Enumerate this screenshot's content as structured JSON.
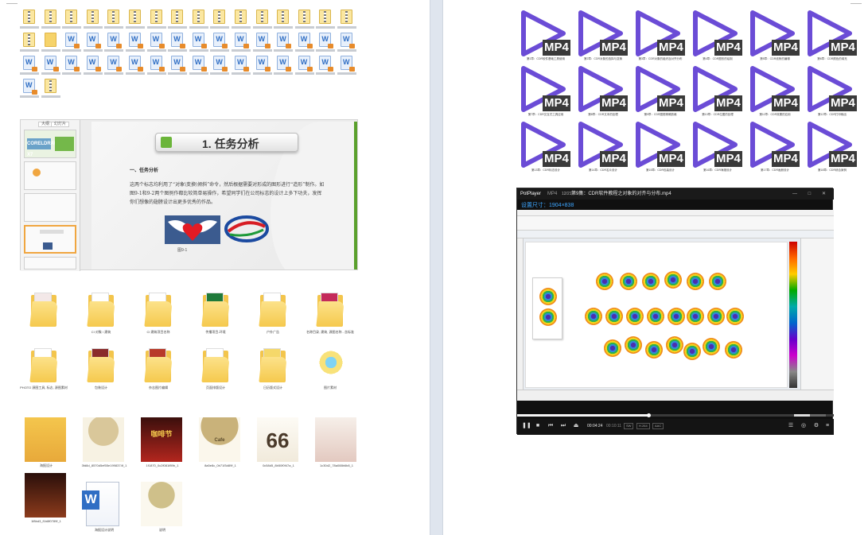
{
  "left_page": {
    "slide": {
      "tabs": [
        "大纲",
        "幻灯片"
      ],
      "title": "1. 任务分析",
      "heading": "一、任务分析",
      "body": "这两个标志均利用了“对象\\变换\\倾斜”命令，然后根据需要对形成的图形进行“造形”制作。如图9-1和9-2两个图例作都比较简单易操作，希望同学们在公司标志的设计上多下功夫，发挥你们想像的翅膀设计出更多优秀的作品。",
      "caption": "图9-1",
      "thumb_logo": "CORELDRAW X7"
    },
    "folders": [
      {
        "label": ""
      },
      {
        "label": "CI 对象 \\ 建筑"
      },
      {
        "label": "CI 建筑项目名称"
      },
      {
        "label": "传播项目-环境"
      },
      {
        "label": "户外广告"
      },
      {
        "label": "名称目录, 建筑, 源图名称 - 含标准信封"
      },
      {
        "label": "PHOTO 源图工具, 标志, 源图素材"
      },
      {
        "label": "包装设计"
      },
      {
        "label": "杂志图片编辑"
      },
      {
        "label": "页面排版设计"
      },
      {
        "label": "日历版式设计"
      },
      {
        "label": "图片素材"
      }
    ],
    "images": [
      {
        "label": "海报设计"
      },
      {
        "label": "3fd8d_8570d5ef55e1998374f_1"
      },
      {
        "label": "1f1870_0c2f081f89b_1"
      },
      {
        "label": "8a5e8c_0b71f3d89f_1"
      },
      {
        "label": "0c58d5_8b50f0f47a_1"
      },
      {
        "label": "1c30d2_78a088b6b8_1"
      },
      {
        "label": "1f8bd3_f1b8f0789f_1"
      },
      {
        "label": "海报设计说明"
      },
      {
        "label": "说明"
      }
    ],
    "image_texts": {
      "badge_66": "66",
      "poster_title": "咖啡节",
      "cup_text": "Cafe"
    }
  },
  "right_page": {
    "mp4_badge": "MP4",
    "videos": [
      "第1章：CDR软件基础工具使用",
      "第2章：CDR对象的选择与变换",
      "第3章：CDR对象的组织及对齐分布",
      "第4章：CDR图形的绘制",
      "第5章：CDR线条的编辑",
      "第6章：CDR颜色的填充",
      "第7章：CDR交互式工具应用",
      "第8章：CDR文本的处理",
      "第9章：CDR图框精确剪裁",
      "第10章：CDR位图的处理",
      "第11章：CDR效果的应用",
      "第12章：CDR打印输出",
      "第13章：CDR标志设计",
      "第14章：CDR名片设计",
      "第15章：CDR包装设计",
      "第16章：CDR海报设计",
      "第17章：CDR画册设计",
      "第18章：CDR综合案例"
    ],
    "player": {
      "app_name": "PotPlayer",
      "format": "MP4",
      "counter": "12/21",
      "title": "第9集：CDR软件教程之对象的对齐与分布.mp4",
      "subtitle": "设置尺寸：1904×838",
      "time_current": "00:04:24",
      "time_total": "00:10:11",
      "pills": [
        "SW",
        "H.264",
        "AAC"
      ],
      "window_controls": "— □ ✕"
    }
  },
  "colors": {
    "mp4_purple": "#6b4cd6",
    "folder_yellow": "#f3c54c",
    "slide_green": "#5aa02c",
    "word_blue": "#2f6ec4"
  }
}
